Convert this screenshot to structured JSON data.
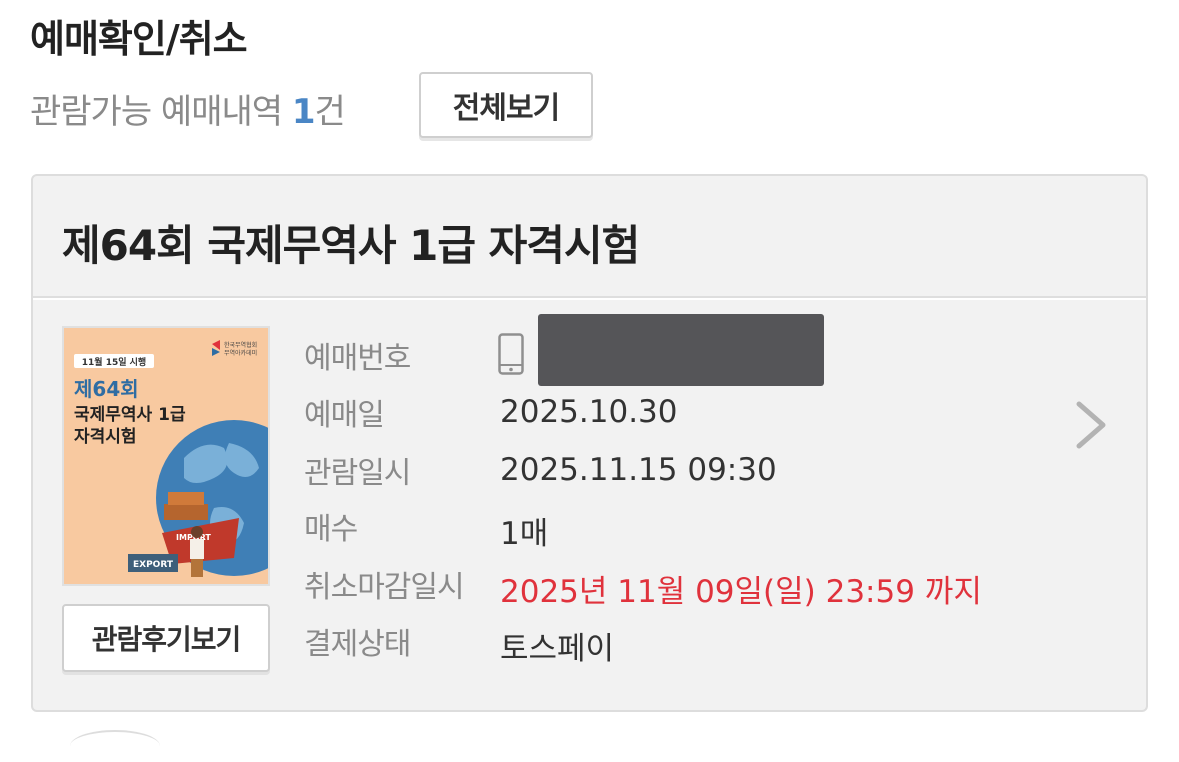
{
  "page": {
    "title": "예매확인/취소"
  },
  "summary": {
    "prefix": "관람가능 예매내역 ",
    "count": "1",
    "suffix": "건",
    "view_all_label": "전체보기"
  },
  "reservation": {
    "title": "제64회 국제무역사 1급 자격시험",
    "poster": {
      "date_badge": "11월 15일 시행",
      "org_name_line1": "한국무역협회",
      "org_name_line2": "무역아카데미",
      "line1": "제64회",
      "line2": "국제무역사 1급",
      "line3": "자격시험",
      "import_label": "IMPORT",
      "export_label": "EXPORT"
    },
    "review_button_label": "관람후기보기",
    "fields": [
      {
        "label": "예매번호",
        "value": ""
      },
      {
        "label": "예매일",
        "value": "2025.10.30"
      },
      {
        "label": "관람일시",
        "value": "2025.11.15 09:30"
      },
      {
        "label": "매수",
        "value": "1매"
      },
      {
        "label": "취소마감일시",
        "value": "2025년 11월 09일(일) 23:59 까지"
      },
      {
        "label": "결제상태",
        "value": "토스페이"
      }
    ],
    "icons": {
      "booking_number": "mobile-phone-icon",
      "details": "chevron-right-icon"
    }
  },
  "colors": {
    "accent_blue": "#4a86c5",
    "deadline_red": "#e0323c",
    "card_background": "#f2f2f2",
    "poster_background": "#f8c9a0"
  }
}
